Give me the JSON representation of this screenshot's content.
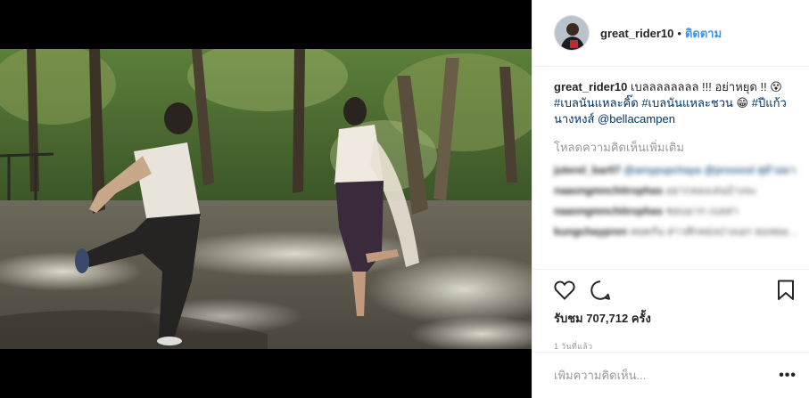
{
  "post": {
    "username": "great_rider10",
    "separator": "•",
    "follow_label": "ติดตาม",
    "caption_text": "เบลลลลลลลล !!! อย่าหยุด !! 😵",
    "hashtag1": "#เบลนันแหละคิ๊ด",
    "hashtag2": "#เบลนันแหละชวน",
    "emoji_grin": "😁",
    "hashtag3": "#ปีแก้วนางหงส์",
    "mention": "@bellacampen",
    "load_more_label": "โหลดความคิดเห็นเพิ่มเติม",
    "views": "รับชม 707,712 ครั้ง",
    "time_ago": "1 วันที่แล้ว",
    "add_comment_placeholder": "เพิ่มความคิดเห็น...",
    "more_menu": "•••"
  },
  "comments": [
    {
      "user": "juterel_bar07",
      "text": "@amypupchaya @prooood สุดำอยากดต"
    },
    {
      "user": "naaongmnchitrophas",
      "text": "อยากลองเล่นบ้างจะ"
    },
    {
      "user": "naaongmnchitrophas",
      "text": "ชอบมาก เบลล่า"
    },
    {
      "user": "kungchaypren",
      "text": "หยดกัน สาวสักหย่งปางเอก ธมหยม ..."
    }
  ],
  "icons": {
    "like": "heart-icon",
    "comment": "comment-icon",
    "save": "bookmark-icon"
  },
  "colors": {
    "link": "#003569",
    "follow": "#3897f0",
    "muted": "#999999"
  }
}
